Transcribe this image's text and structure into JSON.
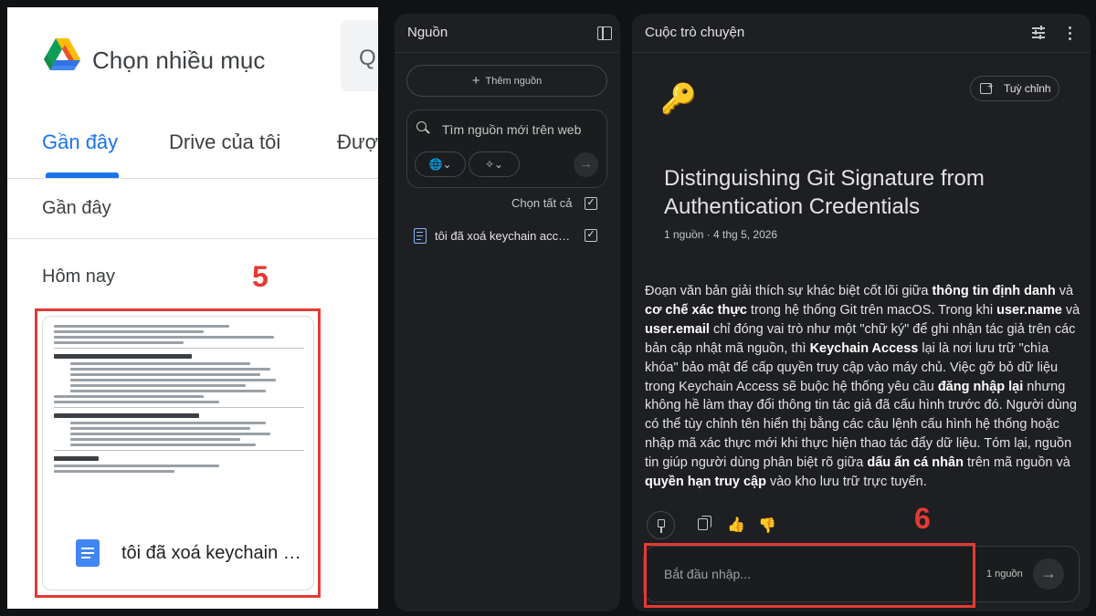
{
  "drive": {
    "title": "Chọn nhiều mục",
    "search_icon_glyph": "Q",
    "tabs": [
      {
        "label": "Gần đây",
        "active": true
      },
      {
        "label": "Drive của tôi",
        "active": false
      },
      {
        "label": "Được",
        "active": false
      }
    ],
    "recent_heading": "Gần đây",
    "today_heading": "Hôm nay",
    "step_marker": "5",
    "file": {
      "name": "tôi đã xoá keychain access",
      "icon": "google-docs-icon"
    },
    "colors": {
      "accent": "#1a73e8",
      "highlight": "#e53935"
    }
  },
  "sources": {
    "title": "Nguồn",
    "add_source_label": "Thêm nguồn",
    "web_search_placeholder": "Tìm nguồn mới trên web",
    "chip_web": "🌐⌄",
    "chip_research": "✧⌄",
    "submit_glyph": "→",
    "select_all_label": "Chọn tất cả",
    "select_all_checked": true,
    "items": [
      {
        "name": "tôi đã xoá keychain access",
        "checked": true,
        "icon": "doc-icon"
      }
    ]
  },
  "chat": {
    "title": "Cuộc trò chuyện",
    "emoji": "🔑",
    "customize_label": "Tuỳ chỉnh",
    "note_title": "Distinguishing Git Signature from Authentication Credentials",
    "note_meta": "1 nguồn · 4 thg 5, 2026",
    "summary": [
      {
        "t": "Đoạn văn bản giải thích sự khác biệt cốt lõi giữa ",
        "b": false
      },
      {
        "t": "thông tin định danh",
        "b": true
      },
      {
        "t": " và ",
        "b": false
      },
      {
        "t": "cơ chế xác thực",
        "b": true
      },
      {
        "t": " trong hệ thống Git trên macOS. Trong khi ",
        "b": false
      },
      {
        "t": "user.name",
        "b": true
      },
      {
        "t": " và ",
        "b": false
      },
      {
        "t": "user.email",
        "b": true
      },
      {
        "t": " chỉ đóng vai trò như một \"chữ ký\" để ghi nhận tác giả trên các bản cập nhật mã nguồn, thì ",
        "b": false
      },
      {
        "t": "Keychain Access",
        "b": true
      },
      {
        "t": " lại là nơi lưu trữ \"chìa khóa\" bảo mật để cấp quyền truy cập vào máy chủ. Việc gỡ bỏ dữ liệu trong Keychain Access sẽ buộc hệ thống yêu cầu ",
        "b": false
      },
      {
        "t": "đăng nhập lại",
        "b": true
      },
      {
        "t": " nhưng không hề làm thay đổi thông tin tác giả đã cấu hình trước đó. Người dùng có thể tùy chỉnh tên hiển thị bằng các câu lệnh cấu hình hệ thống hoặc nhập mã xác thực mới khi thực hiện thao tác đẩy dữ liệu. Tóm lại, nguồn tin giúp người dùng phân biệt rõ giữa ",
        "b": false
      },
      {
        "t": "dấu ấn cá nhân",
        "b": true
      },
      {
        "t": " trên mã nguồn và ",
        "b": false
      },
      {
        "t": "quyền hạn truy cập",
        "b": true
      },
      {
        "t": " vào kho lưu trữ trực tuyến.",
        "b": false
      }
    ],
    "thumbs_up_glyph": "👍",
    "thumbs_down_glyph": "👎",
    "step_marker": "6",
    "composer_placeholder": "Bắt đầu nhập...",
    "source_count": "1 nguồn",
    "send_glyph": "→",
    "colors": {
      "panel": "#1e1f22",
      "highlight": "#e53935"
    }
  }
}
